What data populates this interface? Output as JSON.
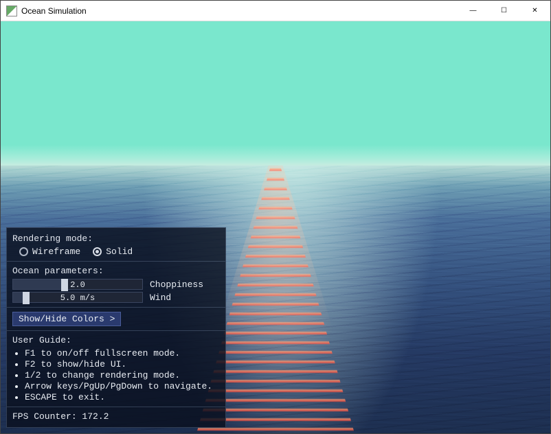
{
  "window": {
    "title": "Ocean Simulation",
    "controls": {
      "minimize": "—",
      "maximize": "☐",
      "close": "✕"
    }
  },
  "panel": {
    "rendering": {
      "label": "Rendering mode:",
      "options": {
        "wireframe": "Wireframe",
        "solid": "Solid"
      },
      "selected": "solid"
    },
    "params": {
      "label": "Ocean parameters:",
      "choppiness": {
        "value_text": "2.0",
        "label": "Choppiness",
        "value": 2.0,
        "min": 0,
        "max": 5,
        "thumb_pct": 40
      },
      "wind": {
        "value_text": "5.0 m/s",
        "label": "Wind",
        "value": 5.0,
        "min": 0,
        "max": 50,
        "thumb_pct": 10
      }
    },
    "colors_button": "Show/Hide Colors >",
    "guide": {
      "label": "User Guide:",
      "items": [
        "F1 to on/off fullscreen mode.",
        "F2 to show/hide UI.",
        "1/2 to change rendering mode.",
        "Arrow keys/PgUp/PgDown to navigate.",
        "ESCAPE to exit."
      ]
    },
    "fps": {
      "label": "FPS Counter: ",
      "value": "172.2"
    }
  }
}
